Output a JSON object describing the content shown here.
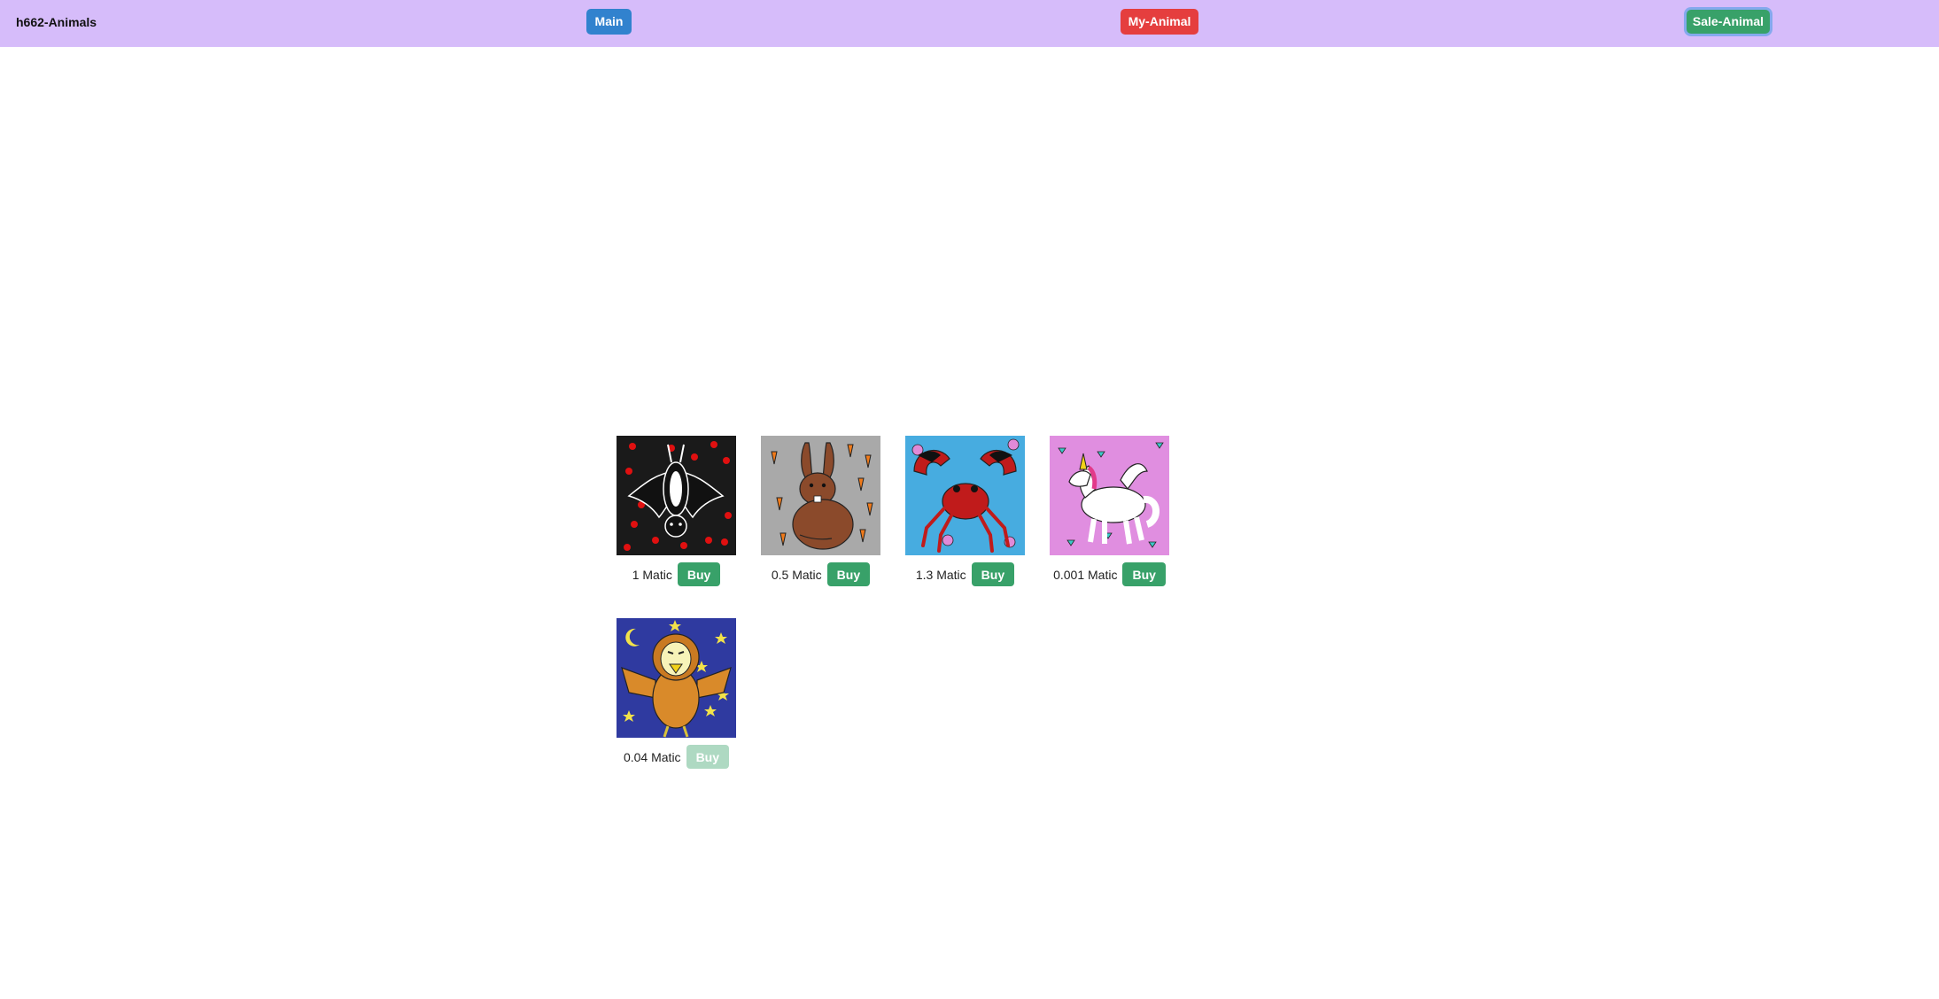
{
  "navbar": {
    "brand": "h662-Animals",
    "main_label": "Main",
    "my_animal_label": "My-Animal",
    "sale_animal_label": "Sale-Animal"
  },
  "cards": [
    {
      "animal": "bat",
      "price": "1 Matic",
      "buy_label": "Buy",
      "disabled": false
    },
    {
      "animal": "rabbit",
      "price": "0.5 Matic",
      "buy_label": "Buy",
      "disabled": false
    },
    {
      "animal": "crab",
      "price": "1.3 Matic",
      "buy_label": "Buy",
      "disabled": false
    },
    {
      "animal": "unicorn",
      "price": "0.001 Matic",
      "buy_label": "Buy",
      "disabled": false
    },
    {
      "animal": "owl",
      "price": "0.04 Matic",
      "buy_label": "Buy",
      "disabled": true
    }
  ],
  "colors": {
    "navbar_bg": "#d6bcfa",
    "main_button": "#3182ce",
    "my_animal_button": "#e53e3e",
    "sale_animal_button": "#38a169",
    "buy_button": "#38a169"
  }
}
